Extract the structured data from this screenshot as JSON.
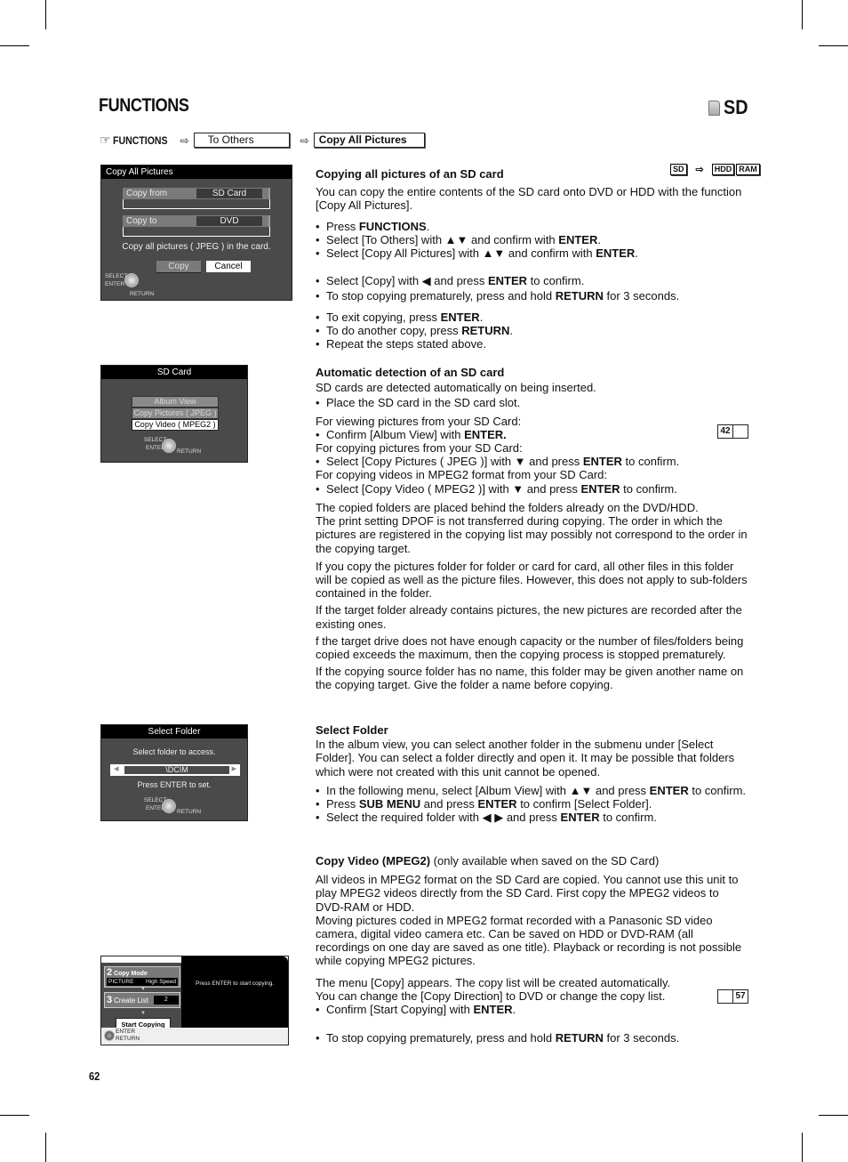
{
  "header": {
    "title": "FUNCTIONS",
    "media_tag": "SD",
    "media_icon": "sd-card-icon"
  },
  "breadcrumb": {
    "icon": "pointing-hand-icon",
    "root": "FUNCTIONS",
    "arrow": "⇨",
    "steps": [
      "To Others",
      "Copy All Pictures"
    ]
  },
  "screens": {
    "copy_all_pictures": {
      "title": "Copy All Pictures",
      "copy_from_label": "Copy from",
      "copy_from_value": "SD Card",
      "copy_to_label": "Copy to",
      "copy_to_value": "DVD",
      "message": "Copy all pictures ( JPEG ) in the card.",
      "copy_button": "Copy",
      "cancel_button": "Cancel",
      "hint_select": "SELECT",
      "hint_enter": "ENTER",
      "hint_return": "RETURN"
    },
    "sd_card": {
      "title": "SD Card",
      "items": [
        "Album View",
        "Copy Pictures ( JPEG )",
        "Copy Video ( MPEG2 )"
      ],
      "selected_index": 2,
      "hint_select": "SELECT",
      "hint_enter": "ENTER",
      "hint_return": "RETURN"
    },
    "select_folder": {
      "title": "Select Folder",
      "prompt": "Select folder to access.",
      "folder_value": "\\DCIM",
      "instruction": "Press ENTER to set.",
      "hint_select": "SELECT",
      "hint_enter": "ENTER",
      "hint_return": "RETURN"
    },
    "copy_video": {
      "step2_num": "2",
      "step2_label": "Copy Mode",
      "step2_type": "PICTURE",
      "step2_speed": "High Speed",
      "step3_num": "3",
      "step3_label": "Create List",
      "step3_value": "2",
      "start_button": "Start Copying",
      "message": "Press ENTER to start copying.",
      "hint_enter": "ENTER",
      "hint_return": "RETURN"
    }
  },
  "sections": {
    "copy_all": {
      "heading": "Copying all pictures of an SD card",
      "badges": {
        "source": "SD",
        "targets": [
          "HDD",
          "RAM"
        ]
      },
      "intro": "You can copy the entire contents of the SD card onto DVD or HDD with the function [Copy All Pictures].",
      "b1_pre": "Press ",
      "b1_bold": "FUNCTIONS",
      "b1_post": ".",
      "b2_pre": "Select [To Others] with ▲▼ and confirm with ",
      "b2_bold": "ENTER",
      "b2_post": ".",
      "b3_pre": "Select [Copy All Pictures] with ▲▼ and confirm with ",
      "b3_bold": "ENTER",
      "b3_post": ".",
      "b4_pre": "Select [Copy] with ◀ and press ",
      "b4_bold": "ENTER",
      "b4_post": " to confirm.",
      "b5_pre": "To stop copying prematurely, press and hold ",
      "b5_bold": "RETURN",
      "b5_post": " for 3 seconds.",
      "b6_pre": "To exit copying, press ",
      "b6_bold": "ENTER",
      "b6_post": ".",
      "b7_pre": "To do another copy, press ",
      "b7_bold": "RETURN",
      "b7_post": ".",
      "b8": "Repeat the steps stated above."
    },
    "auto_detect": {
      "heading": "Automatic detection of an SD card",
      "line1": "SD cards are detected automatically on being inserted.",
      "b1": "Place the SD card in the SD card slot.",
      "view_intro": "For viewing pictures from your SD Card:",
      "view_pre": "Confirm [Album View] with ",
      "view_bold": "ENTER.",
      "page_ref": "42",
      "copy_pic_intro": "For copying pictures from your SD Card:",
      "copy_pic_pre": "Select [Copy Pictures ( JPEG )] with ▼ and press ",
      "copy_pic_bold": "ENTER",
      "copy_pic_post": " to confirm.",
      "copy_vid_intro": "For copying videos in MPEG2 format from your SD Card:",
      "copy_vid_pre": "Select [Copy Video ( MPEG2 )] with ▼ and press ",
      "copy_vid_bold": "ENTER",
      "copy_vid_post": " to confirm."
    },
    "notes": {
      "p1": "The copied folders are placed behind the folders already on the DVD/HDD.",
      "p2": "The print setting DPOF is not transferred during copying. The order in which the pictures are registered in the copying list may possibly not correspond to the order in the copying target.",
      "p3": "If you copy the pictures folder for folder or card for card, all other files in this folder will be copied as well as the picture files. However, this does not apply to sub-folders contained in the folder.",
      "p4": "If the target folder already contains pictures, the new pictures are recorded after the existing ones.",
      "p5": "f the target drive does not have enough capacity or the number of files/folders being copied exceeds the maximum, then the copying process is stopped prematurely.",
      "p6": "If the copying source folder has no name, this folder may be given another name on the copying target. Give the folder a name before copying."
    },
    "select_folder": {
      "heading": "Select Folder",
      "intro": "In the album view, you can select another folder in the submenu under [Select Folder]. You can select a folder directly and open it. It may be possible that folders which were not created with this unit cannot be opened.",
      "b1_pre": "In the following menu, select [Album View] with ▲▼ and press ",
      "b1_bold": "ENTER",
      "b1_post": " to confirm.",
      "b2_pre": "Press ",
      "b2_bold1": "SUB MENU",
      "b2_mid": " and press ",
      "b2_bold2": "ENTER",
      "b2_post": " to confirm [Select Folder].",
      "b3_pre": "Select the required folder with ◀ ▶ and press ",
      "b3_bold": "ENTER",
      "b3_post": " to confirm."
    },
    "copy_video": {
      "heading": "Copy Video (MPEG2)",
      "heading_note": " (only available when saved on the SD Card)",
      "p1": "All videos in MPEG2 format on the SD Card are copied. You cannot use this unit to play  MPEG2 videos directly from the SD Card. First copy the MPEG2 videos to DVD-RAM or HDD.",
      "p2": "Moving pictures coded in MPEG2 format recorded with a Panasonic SD video camera, digital video camera etc. Can be saved on HDD or DVD-RAM (all recordings on one day are saved as one title). Playback or recording is not possible while copying  MPEG2 pictures.",
      "p3": "The menu [Copy] appears. The copy list will be created automatically.",
      "p4": "You can change the [Copy Direction] to DVD or change the copy list.",
      "page_ref": "57",
      "b1_pre": "Confirm [Start Copying] with ",
      "b1_bold": "ENTER",
      "b1_post": ".",
      "b2_pre": "To stop copying prematurely, press and hold ",
      "b2_bold": "RETURN",
      "b2_post": " for 3 seconds."
    }
  },
  "footer": {
    "page_number": "62"
  }
}
